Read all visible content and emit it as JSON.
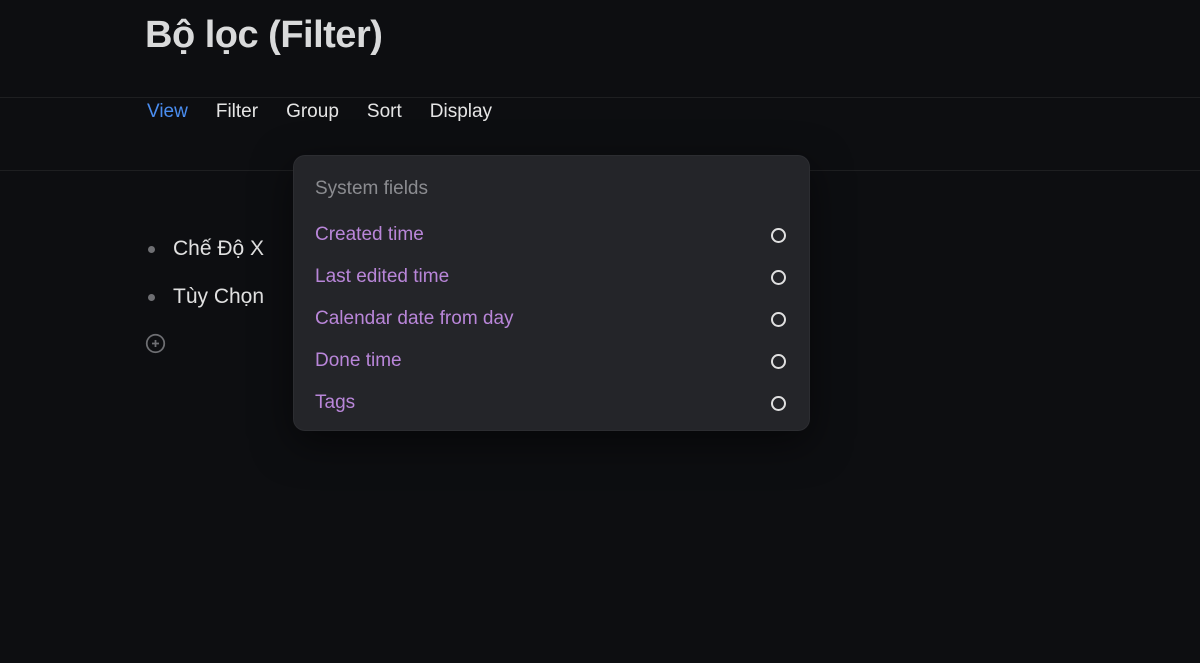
{
  "page": {
    "title": "Bộ lọc (Filter)"
  },
  "tabs": {
    "view": "View",
    "filter": "Filter",
    "group": "Group",
    "sort": "Sort",
    "display": "Display"
  },
  "list": {
    "item0": "Chế Độ X",
    "item1": "Tùy Chọn"
  },
  "dropdown": {
    "header": "System fields",
    "items": {
      "i0": "Created time",
      "i1": "Last edited time",
      "i2": "Calendar date from day",
      "i3": "Done time",
      "i4": "Tags"
    }
  },
  "colors": {
    "accent": "#4a8df0",
    "item_text": "#b986d9"
  }
}
